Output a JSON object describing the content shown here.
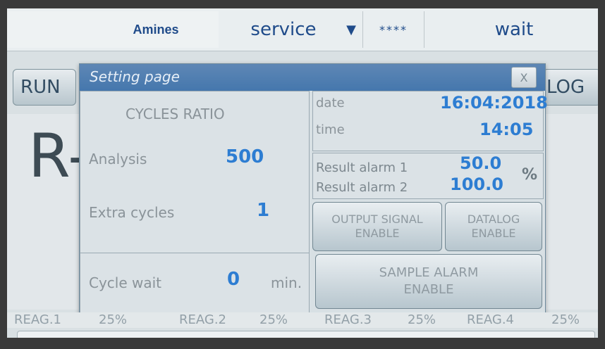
{
  "topbar": {
    "app_name": "Amines",
    "mode": "service",
    "password_mask": "****",
    "status": "wait"
  },
  "nav": {
    "run_label": "RUN",
    "log_label": "LOG",
    "bg_text": "R-"
  },
  "modal": {
    "title": "Setting page",
    "close_label": "X",
    "cycles_ratio_title": "CYCLES RATIO",
    "analysis_label": "Analysis",
    "analysis_value": "500",
    "extra_cycles_label": "Extra cycles",
    "extra_cycles_value": "1",
    "cycle_wait_label": "Cycle wait",
    "cycle_wait_value": "0",
    "cycle_wait_unit": "min.",
    "date_label": "date",
    "date_value": "16:04:2018",
    "time_label": "time",
    "time_value": "14:05",
    "result_alarm1_label": "Result alarm 1",
    "result_alarm1_value": "50.0",
    "result_alarm2_label": "Result alarm 2",
    "result_alarm2_value": "100.0",
    "result_unit": "%",
    "output_signal_line1": "OUTPUT SIGNAL",
    "output_signal_line2": "ENABLE",
    "datalog_line1": "DATALOG",
    "datalog_line2": "ENABLE",
    "sample_alarm_line1": "SAMPLE ALARM",
    "sample_alarm_line2": "ENABLE"
  },
  "status_bar": {
    "reag1_label": "REAG.1",
    "reag1_value": "25%",
    "reag2_label": "REAG.2",
    "reag2_value": "25%",
    "reag3_label": "REAG.3",
    "reag3_value": "25%",
    "reag4_label": "REAG.4",
    "reag4_value": "25%"
  }
}
